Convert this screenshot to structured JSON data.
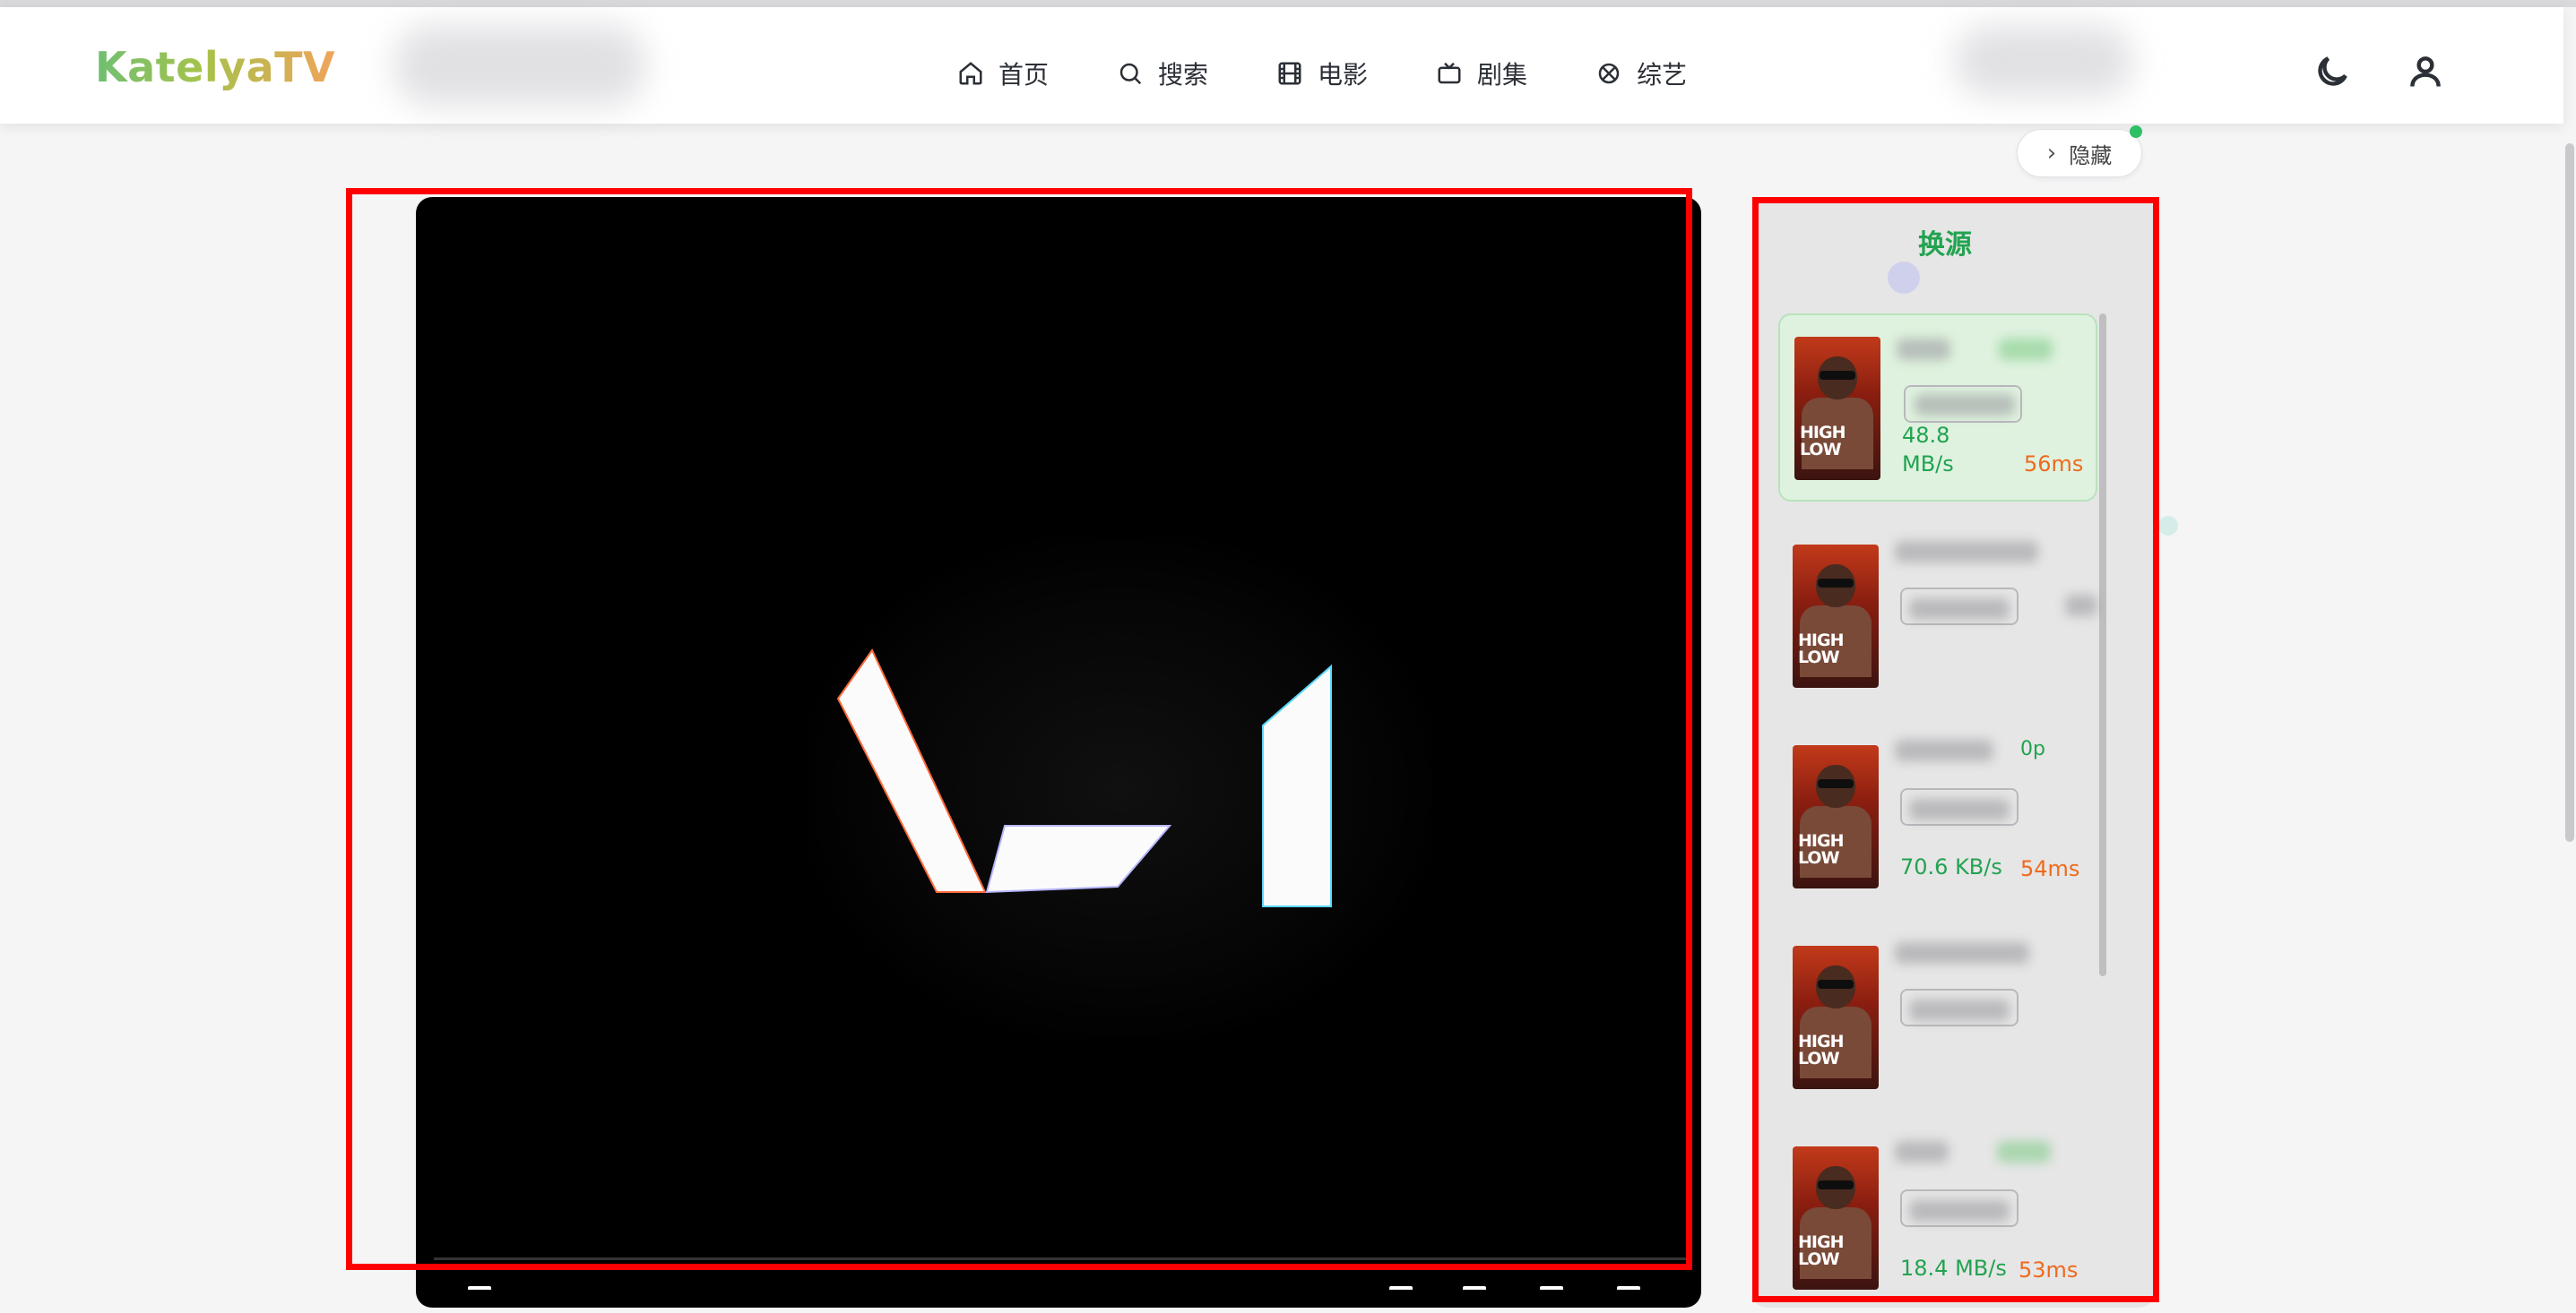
{
  "app": {
    "logo": "KatelyaTV"
  },
  "nav": {
    "items": [
      {
        "label": "首页",
        "icon": "home-icon"
      },
      {
        "label": "搜索",
        "icon": "search-icon"
      },
      {
        "label": "电影",
        "icon": "film-icon"
      },
      {
        "label": "剧集",
        "icon": "tv-icon"
      },
      {
        "label": "综艺",
        "icon": "variety-icon"
      }
    ]
  },
  "header": {
    "theme_icon": "moon-icon",
    "user_icon": "user-icon"
  },
  "sidebar_toggle": {
    "label": "隐藏",
    "icon": "chevron-right-icon"
  },
  "panel": {
    "title": "换源",
    "sources": [
      {
        "speed": "48.8 MB/s",
        "ping": "56ms",
        "active": true,
        "poster_text": "HIGH LOW"
      },
      {
        "speed": "",
        "ping": "",
        "active": false,
        "poster_text": "HIGH LOW"
      },
      {
        "speed": "70.6 KB/s",
        "ping": "54ms",
        "active": false,
        "resolution": "0p",
        "poster_text": "HIGH LOW"
      },
      {
        "speed": "",
        "ping": "",
        "active": false,
        "poster_text": "HIGH LOW"
      },
      {
        "speed": "18.4 MB/s",
        "ping": "53ms",
        "active": false,
        "poster_text": "HIGH LOW"
      }
    ]
  },
  "colors": {
    "accent": "#22a350",
    "ping": "#ef6a1e",
    "highlight": "#ff0000"
  }
}
